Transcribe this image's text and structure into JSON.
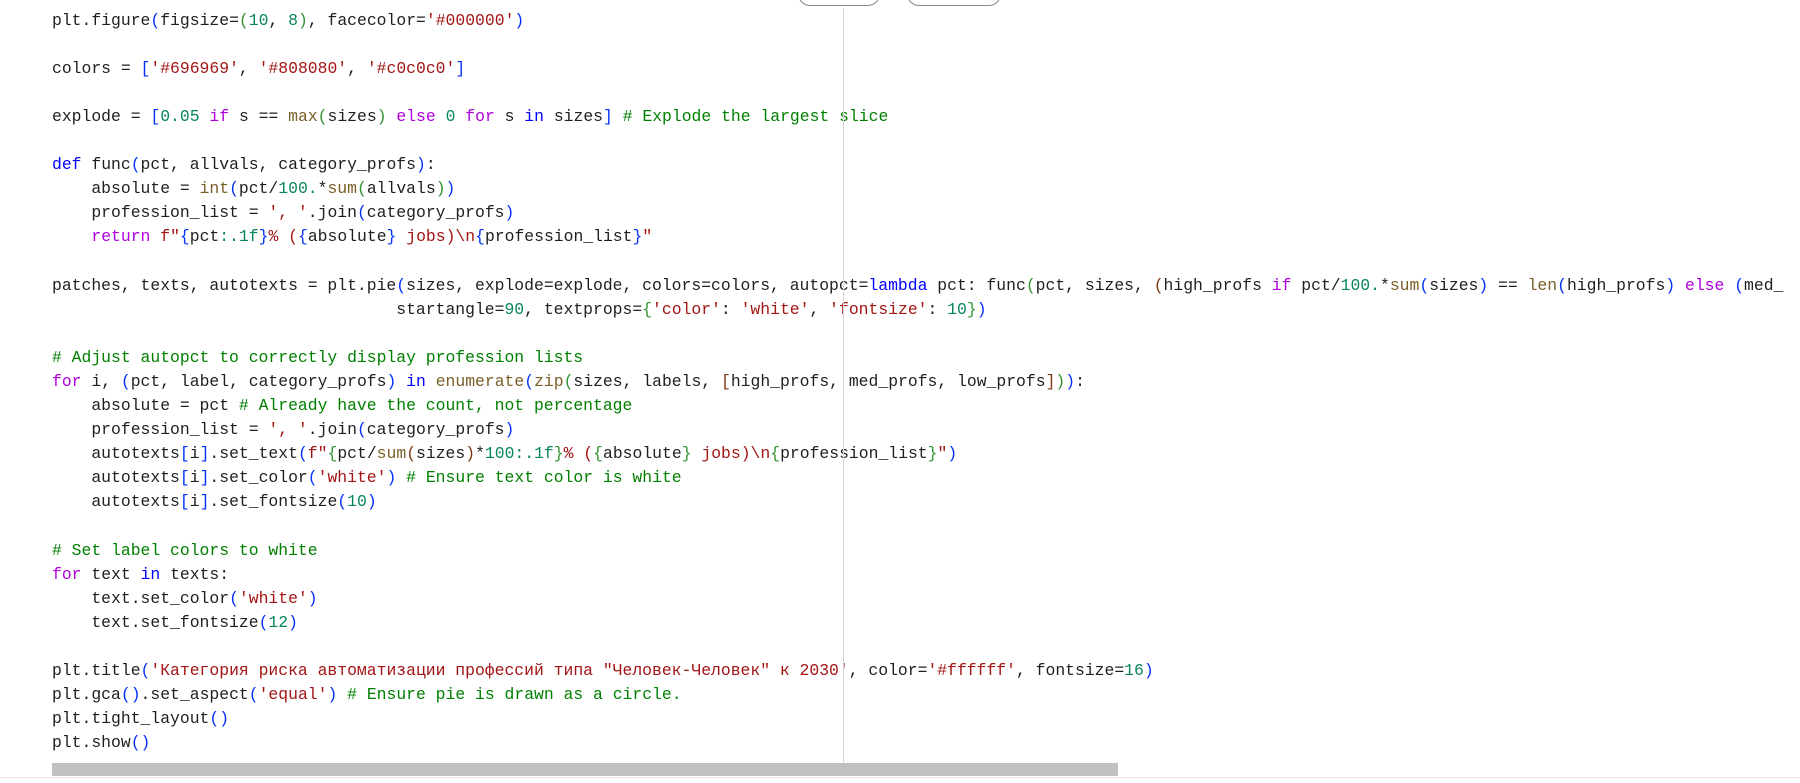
{
  "code": {
    "lines": [
      [
        [
          "p",
          "plt.figure"
        ],
        [
          "b1",
          "("
        ],
        [
          "p",
          "figsize="
        ],
        [
          "b2",
          "("
        ],
        [
          "n",
          "10"
        ],
        [
          "p",
          ", "
        ],
        [
          "n",
          "8"
        ],
        [
          "b2",
          ")"
        ],
        [
          "p",
          ", facecolor="
        ],
        [
          "s",
          "'#000000'"
        ],
        [
          "b1",
          ")"
        ]
      ],
      [],
      [
        [
          "p",
          "colors = "
        ],
        [
          "b1",
          "["
        ],
        [
          "s",
          "'#696969'"
        ],
        [
          "p",
          ", "
        ],
        [
          "s",
          "'#808080'"
        ],
        [
          "p",
          ", "
        ],
        [
          "s",
          "'#c0c0c0'"
        ],
        [
          "b1",
          "]"
        ]
      ],
      [],
      [
        [
          "p",
          "explode = "
        ],
        [
          "b1",
          "["
        ],
        [
          "n",
          "0.05"
        ],
        [
          "p",
          " "
        ],
        [
          "k",
          "if"
        ],
        [
          "p",
          " s == "
        ],
        [
          "f",
          "max"
        ],
        [
          "b2",
          "("
        ],
        [
          "p",
          "sizes"
        ],
        [
          "b2",
          ")"
        ],
        [
          "p",
          " "
        ],
        [
          "k",
          "else"
        ],
        [
          "p",
          " "
        ],
        [
          "n",
          "0"
        ],
        [
          "p",
          " "
        ],
        [
          "k",
          "for"
        ],
        [
          "p",
          " s "
        ],
        [
          "d",
          "in"
        ],
        [
          "p",
          " sizes"
        ],
        [
          "b1",
          "]"
        ],
        [
          "p",
          " "
        ],
        [
          "c",
          "# Explode the largest slice"
        ]
      ],
      [],
      [
        [
          "d",
          "def"
        ],
        [
          "p",
          " func"
        ],
        [
          "b1",
          "("
        ],
        [
          "p",
          "pct, allvals, category_profs"
        ],
        [
          "b1",
          ")"
        ],
        [
          "p",
          ":"
        ]
      ],
      [
        [
          "p",
          "    absolute = "
        ],
        [
          "f",
          "int"
        ],
        [
          "b1",
          "("
        ],
        [
          "p",
          "pct/"
        ],
        [
          "n",
          "100."
        ],
        [
          "p",
          "*"
        ],
        [
          "f",
          "sum"
        ],
        [
          "b2",
          "("
        ],
        [
          "p",
          "allvals"
        ],
        [
          "b2",
          ")"
        ],
        [
          "b1",
          ")"
        ]
      ],
      [
        [
          "p",
          "    profession_list = "
        ],
        [
          "s",
          "', '"
        ],
        [
          "p",
          ".join"
        ],
        [
          "b1",
          "("
        ],
        [
          "p",
          "category_profs"
        ],
        [
          "b1",
          ")"
        ]
      ],
      [
        [
          "p",
          "    "
        ],
        [
          "k",
          "return"
        ],
        [
          "p",
          " "
        ],
        [
          "s",
          "f\""
        ],
        [
          "b1",
          "{"
        ],
        [
          "p",
          "pct"
        ],
        [
          "n",
          ":.1f"
        ],
        [
          "b1",
          "}"
        ],
        [
          "s",
          "% ("
        ],
        [
          "b1",
          "{"
        ],
        [
          "p",
          "absolute"
        ],
        [
          "b1",
          "}"
        ],
        [
          "s",
          " jobs)\\n"
        ],
        [
          "b1",
          "{"
        ],
        [
          "p",
          "profession_list"
        ],
        [
          "b1",
          "}"
        ],
        [
          "s",
          "\""
        ]
      ],
      [],
      [
        [
          "p",
          "patches, texts, autotexts = plt.pie"
        ],
        [
          "b1",
          "("
        ],
        [
          "p",
          "sizes, explode=explode, colors=colors, autopct="
        ],
        [
          "d",
          "lambda"
        ],
        [
          "p",
          " pct: func"
        ],
        [
          "b2",
          "("
        ],
        [
          "p",
          "pct, sizes, "
        ],
        [
          "b3",
          "("
        ],
        [
          "p",
          "high_profs "
        ],
        [
          "k",
          "if"
        ],
        [
          "p",
          " pct/"
        ],
        [
          "n",
          "100."
        ],
        [
          "p",
          "*"
        ],
        [
          "f",
          "sum"
        ],
        [
          "b1",
          "("
        ],
        [
          "p",
          "sizes"
        ],
        [
          "b1",
          ")"
        ],
        [
          "p",
          " == "
        ],
        [
          "f",
          "len"
        ],
        [
          "b1",
          "("
        ],
        [
          "p",
          "high_profs"
        ],
        [
          "b1",
          ")"
        ],
        [
          "p",
          " "
        ],
        [
          "k",
          "else"
        ],
        [
          "p",
          " "
        ],
        [
          "b1",
          "("
        ],
        [
          "p",
          "med_"
        ]
      ],
      [
        [
          "p",
          "                                   startangle="
        ],
        [
          "n",
          "90"
        ],
        [
          "p",
          ", textprops="
        ],
        [
          "b2",
          "{"
        ],
        [
          "s",
          "'color'"
        ],
        [
          "p",
          ": "
        ],
        [
          "s",
          "'white'"
        ],
        [
          "p",
          ", "
        ],
        [
          "s",
          "'fontsize'"
        ],
        [
          "p",
          ": "
        ],
        [
          "n",
          "10"
        ],
        [
          "b2",
          "}"
        ],
        [
          "b1",
          ")"
        ]
      ],
      [],
      [
        [
          "c",
          "# Adjust autopct to correctly display profession lists"
        ]
      ],
      [
        [
          "k",
          "for"
        ],
        [
          "p",
          " i, "
        ],
        [
          "b1",
          "("
        ],
        [
          "p",
          "pct, label, category_profs"
        ],
        [
          "b1",
          ")"
        ],
        [
          "p",
          " "
        ],
        [
          "d",
          "in"
        ],
        [
          "p",
          " "
        ],
        [
          "f",
          "enumerate"
        ],
        [
          "b1",
          "("
        ],
        [
          "f",
          "zip"
        ],
        [
          "b2",
          "("
        ],
        [
          "p",
          "sizes, labels, "
        ],
        [
          "b3",
          "["
        ],
        [
          "p",
          "high_profs, med_profs, low_profs"
        ],
        [
          "b3",
          "]"
        ],
        [
          "b2",
          ")"
        ],
        [
          "b1",
          ")"
        ],
        [
          "p",
          ":"
        ]
      ],
      [
        [
          "p",
          "    absolute = pct "
        ],
        [
          "c",
          "# Already have the count, not percentage"
        ]
      ],
      [
        [
          "p",
          "    profession_list = "
        ],
        [
          "s",
          "', '"
        ],
        [
          "p",
          ".join"
        ],
        [
          "b1",
          "("
        ],
        [
          "p",
          "category_profs"
        ],
        [
          "b1",
          ")"
        ]
      ],
      [
        [
          "p",
          "    autotexts"
        ],
        [
          "b1",
          "["
        ],
        [
          "p",
          "i"
        ],
        [
          "b1",
          "]"
        ],
        [
          "p",
          ".set_text"
        ],
        [
          "b1",
          "("
        ],
        [
          "s",
          "f\""
        ],
        [
          "b2",
          "{"
        ],
        [
          "p",
          "pct/"
        ],
        [
          "f",
          "sum"
        ],
        [
          "b3",
          "("
        ],
        [
          "p",
          "sizes"
        ],
        [
          "b3",
          ")"
        ],
        [
          "p",
          "*"
        ],
        [
          "n",
          "100"
        ],
        [
          "n",
          ":.1f"
        ],
        [
          "b2",
          "}"
        ],
        [
          "s",
          "% ("
        ],
        [
          "b2",
          "{"
        ],
        [
          "p",
          "absolute"
        ],
        [
          "b2",
          "}"
        ],
        [
          "s",
          " jobs)\\n"
        ],
        [
          "b2",
          "{"
        ],
        [
          "p",
          "profession_list"
        ],
        [
          "b2",
          "}"
        ],
        [
          "s",
          "\""
        ],
        [
          "b1",
          ")"
        ]
      ],
      [
        [
          "p",
          "    autotexts"
        ],
        [
          "b1",
          "["
        ],
        [
          "p",
          "i"
        ],
        [
          "b1",
          "]"
        ],
        [
          "p",
          ".set_color"
        ],
        [
          "b1",
          "("
        ],
        [
          "s",
          "'white'"
        ],
        [
          "b1",
          ")"
        ],
        [
          "p",
          " "
        ],
        [
          "c",
          "# Ensure text color is white"
        ]
      ],
      [
        [
          "p",
          "    autotexts"
        ],
        [
          "b1",
          "["
        ],
        [
          "p",
          "i"
        ],
        [
          "b1",
          "]"
        ],
        [
          "p",
          ".set_fontsize"
        ],
        [
          "b1",
          "("
        ],
        [
          "n",
          "10"
        ],
        [
          "b1",
          ")"
        ]
      ],
      [],
      [
        [
          "c",
          "# Set label colors to white"
        ]
      ],
      [
        [
          "k",
          "for"
        ],
        [
          "p",
          " text "
        ],
        [
          "d",
          "in"
        ],
        [
          "p",
          " texts:"
        ]
      ],
      [
        [
          "p",
          "    text.set_color"
        ],
        [
          "b1",
          "("
        ],
        [
          "s",
          "'white'"
        ],
        [
          "b1",
          ")"
        ]
      ],
      [
        [
          "p",
          "    text.set_fontsize"
        ],
        [
          "b1",
          "("
        ],
        [
          "n",
          "12"
        ],
        [
          "b1",
          ")"
        ]
      ],
      [],
      [
        [
          "p",
          "plt.title"
        ],
        [
          "b1",
          "("
        ],
        [
          "s",
          "'Категория риска автоматизации профессий типа \"Человек-Человек\" к 2030'"
        ],
        [
          "p",
          ", color="
        ],
        [
          "s",
          "'#ffffff'"
        ],
        [
          "p",
          ", fontsize="
        ],
        [
          "n",
          "16"
        ],
        [
          "b1",
          ")"
        ]
      ],
      [
        [
          "p",
          "plt.gca"
        ],
        [
          "b1",
          "("
        ],
        [
          "b1",
          ")"
        ],
        [
          "p",
          ".set_aspect"
        ],
        [
          "b1",
          "("
        ],
        [
          "s",
          "'equal'"
        ],
        [
          "b1",
          ")"
        ],
        [
          "p",
          " "
        ],
        [
          "c",
          "# Ensure pie is drawn as a circle."
        ]
      ],
      [
        [
          "p",
          "plt.tight_layout"
        ],
        [
          "b1",
          "("
        ],
        [
          "b1",
          ")"
        ]
      ],
      [
        [
          "p",
          "plt.show"
        ],
        [
          "b1",
          "("
        ],
        [
          "b1",
          ")"
        ]
      ]
    ]
  },
  "colors": {
    "keyword": "#af00db",
    "storage": "#0000ff",
    "function": "#795e26",
    "number": "#098658",
    "string": "#a31515",
    "comment": "#008000",
    "scrollbar": "#c1c1c0"
  }
}
